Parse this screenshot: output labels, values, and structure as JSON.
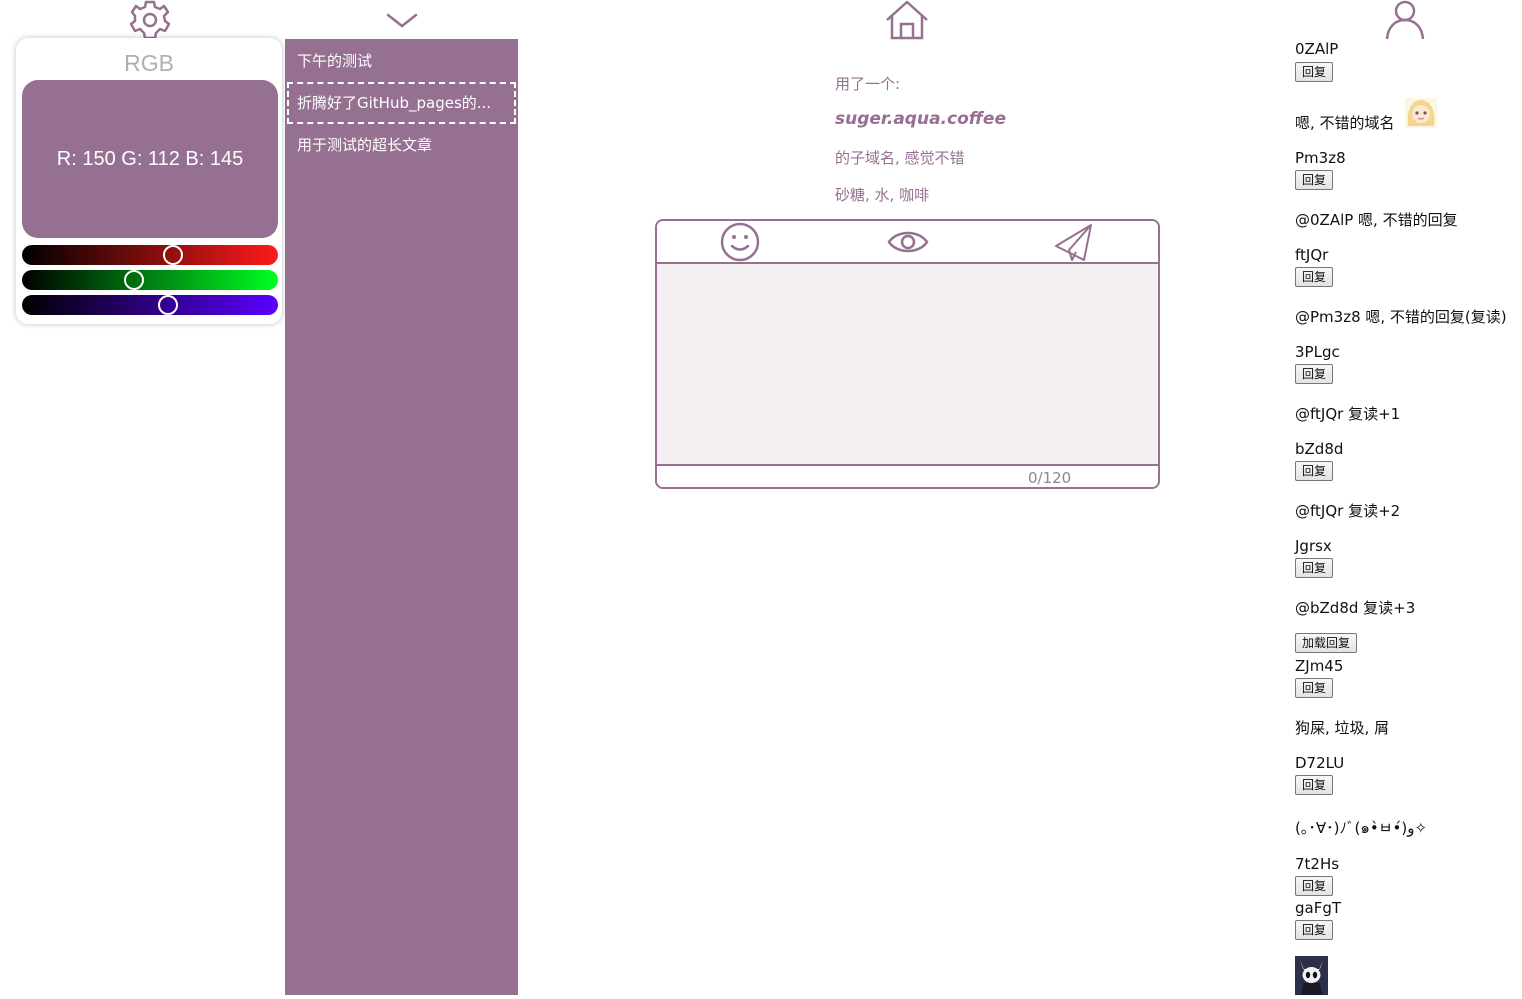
{
  "color_panel": {
    "title": "RGB",
    "value_text": "R: 150 G: 112 B: 145",
    "r": 150,
    "g": 112,
    "b": 145,
    "swatch_color": "#967091"
  },
  "theme": {
    "accent": "#967091",
    "editor_bg": "#f4eff3"
  },
  "nav": {
    "settings_icon": "gear-icon",
    "toggle_icon": "chevron-down-icon",
    "home_icon": "home-icon",
    "user_icon": "user-icon"
  },
  "sidebar": {
    "items": [
      {
        "label": "下午的测试"
      },
      {
        "label": "折腾好了GitHub_pages的..."
      },
      {
        "label": "用于测试的超长文章"
      }
    ]
  },
  "article": {
    "line1": "用了一个:",
    "domain": "suger.aqua.coffee",
    "line3": "的子域名, 感觉不错",
    "line4": "砂糖, 水, 咖啡"
  },
  "editor": {
    "emoji_icon": "smiley-icon",
    "preview_icon": "eye-icon",
    "send_icon": "paper-plane-icon",
    "counter": "0/120"
  },
  "comments": {
    "reply_label": "回复",
    "load_replies_label": "加载回复",
    "items": [
      {
        "name": "0ZAlP",
        "text": "嗯, 不错的域名"
      },
      {
        "name": "Pm3z8",
        "text": "@0ZAlP 嗯, 不错的回复"
      },
      {
        "name": "ftJQr",
        "text": "@Pm3z8 嗯, 不错的回复(复读)"
      },
      {
        "name": "3PLgc",
        "text": "@ftJQr 复读+1"
      },
      {
        "name": "bZd8d",
        "text": "@ftJQr 复读+2"
      },
      {
        "name": "Jgrsx",
        "text": "@bZd8d 复读+3"
      },
      {
        "name": "ZJm45",
        "text": "狗屎, 垃圾, 屑"
      },
      {
        "name": "D72LU",
        "text": "(｡･∀･)ﾉﾞ(๑•̀ㅂ•́)و✧"
      },
      {
        "name": "7t2Hs",
        "text": ""
      },
      {
        "name": "gaFgT",
        "text": ""
      }
    ]
  }
}
